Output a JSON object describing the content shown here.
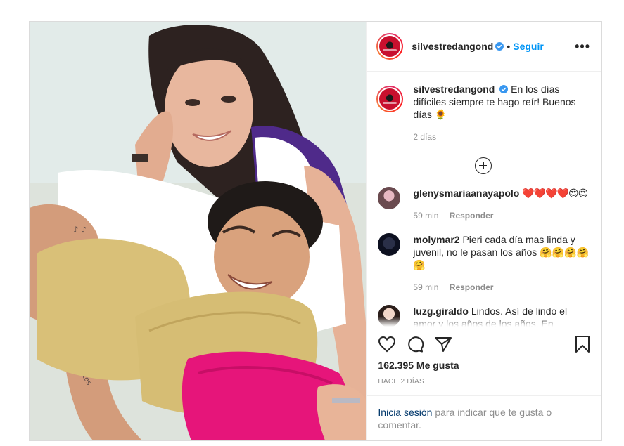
{
  "post": {
    "username": "silvestredangond",
    "dot": "•",
    "follow_label": "Seguir",
    "more_label": "•••",
    "caption": "En los días difíciles siempre te hago reír! Buenos días 🌻",
    "caption_time": "2 días",
    "likes": "162.395 Me gusta",
    "date": "HACE 2 DÍAS"
  },
  "comments": [
    {
      "user": "glenysmariaanayapolo",
      "text": "❤️❤️❤️❤️😍😍",
      "time": "59 min",
      "reply": "Responder"
    },
    {
      "user": "molymar2",
      "text": "Pieri cada día mas linda y juvenil, no le pasan los años 🤗🤗🤗🤗🤗",
      "time": "59 min",
      "reply": "Responder"
    },
    {
      "user": "luzg.giraldo",
      "text": "Lindos. Así de lindo el amor y los años de los años. En",
      "time": "",
      "reply": ""
    }
  ],
  "login": {
    "link": "Inicia sesión",
    "rest": " para indicar que te gusta o comentar."
  },
  "colors": {
    "accent": "#0095f6",
    "verified": "#3897f0",
    "text": "#262626",
    "muted": "#8e8e8e",
    "border": "#dbdbdb"
  },
  "icons": [
    "verified-icon",
    "more-icon",
    "add-comment-icon",
    "heart-icon",
    "comment-icon",
    "share-icon",
    "save-icon"
  ]
}
